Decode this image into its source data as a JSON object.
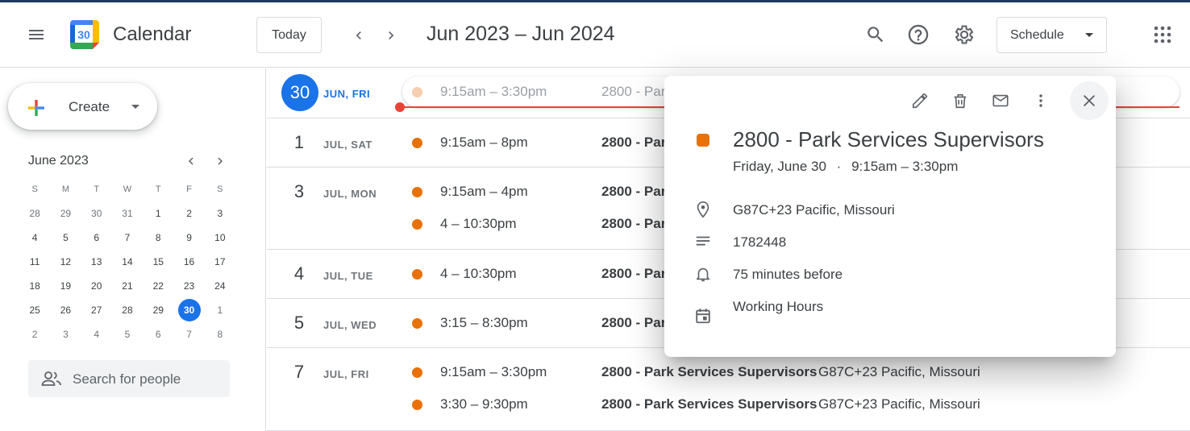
{
  "app": {
    "title": "Calendar",
    "logo_day": "30"
  },
  "header": {
    "today_label": "Today",
    "date_range": "Jun 2023 – Jun 2024",
    "view_label": "Schedule",
    "icons": [
      "menu-icon",
      "search-icon",
      "help-icon",
      "settings-icon",
      "apps-icon"
    ]
  },
  "sidebar": {
    "create_label": "Create",
    "mini_calendar": {
      "title": "June 2023",
      "weekdays": [
        "S",
        "M",
        "T",
        "W",
        "T",
        "F",
        "S"
      ],
      "weeks": [
        [
          "28",
          "29",
          "30",
          "31",
          "1",
          "2",
          "3"
        ],
        [
          "4",
          "5",
          "6",
          "7",
          "8",
          "9",
          "10"
        ],
        [
          "11",
          "12",
          "13",
          "14",
          "15",
          "16",
          "17"
        ],
        [
          "18",
          "19",
          "20",
          "21",
          "22",
          "23",
          "24"
        ],
        [
          "25",
          "26",
          "27",
          "28",
          "29",
          "30",
          "1"
        ],
        [
          "2",
          "3",
          "4",
          "5",
          "6",
          "7",
          "8"
        ]
      ],
      "selected_day": "30"
    },
    "search_people_placeholder": "Search for people"
  },
  "schedule": {
    "days": [
      {
        "num": "30",
        "label": "JUN, FRI",
        "is_today": true,
        "events": [
          {
            "time": "9:15am – 3:30pm",
            "title": "2800 - Par",
            "location": "",
            "past": true
          }
        ]
      },
      {
        "num": "1",
        "label": "JUL, SAT",
        "events": [
          {
            "time": "9:15am – 8pm",
            "title": "2800 - Par",
            "location": ""
          }
        ]
      },
      {
        "num": "3",
        "label": "JUL, MON",
        "events": [
          {
            "time": "9:15am – 4pm",
            "title": "2800 - Par",
            "location": ""
          },
          {
            "time": "4 – 10:30pm",
            "title": "2800 - Par",
            "location": ""
          }
        ]
      },
      {
        "num": "4",
        "label": "JUL, TUE",
        "events": [
          {
            "time": "4 – 10:30pm",
            "title": "2800 - Par",
            "location": ""
          }
        ]
      },
      {
        "num": "5",
        "label": "JUL, WED",
        "events": [
          {
            "time": "3:15 – 8:30pm",
            "title": "2800 - Par",
            "location": ""
          }
        ]
      },
      {
        "num": "7",
        "label": "JUL, FRI",
        "events": [
          {
            "time": "9:15am – 3:30pm",
            "title": "2800 - Park Services Supervisors",
            "location": "G87C+23 Pacific, Missouri"
          },
          {
            "time": "3:30 – 9:30pm",
            "title": "2800 - Park Services Supervisors",
            "location": "G87C+23 Pacific, Missouri"
          }
        ]
      }
    ],
    "event_color": "#e8710a"
  },
  "popup": {
    "title": "2800 - Park Services Supervisors",
    "date": "Friday, June 30",
    "separator": "·",
    "time": "9:15am – 3:30pm",
    "location": "G87C+23 Pacific, Missouri",
    "description": "1782448",
    "reminder": "75 minutes before",
    "calendar": "Working Hours",
    "color": "#e8710a"
  }
}
